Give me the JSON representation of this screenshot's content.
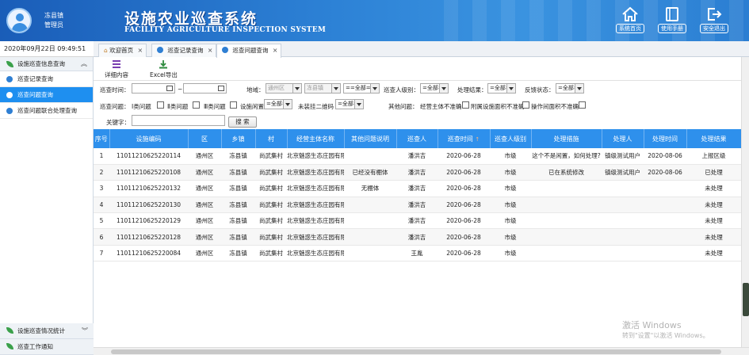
{
  "user": {
    "name": "冻县镇",
    "role": "管理员"
  },
  "system": {
    "title": "设施农业巡查系统",
    "subtitle": "FACILITY AGRICULTURE INSPECTION SYSTEM"
  },
  "header_buttons": [
    {
      "label": "系统首页",
      "icon": "home-icon"
    },
    {
      "label": "使用手册",
      "icon": "book-icon"
    },
    {
      "label": "安全退出",
      "icon": "logout-icon"
    }
  ],
  "datetime": "2020年09月22日 09:49:51",
  "sidebar": {
    "group_top": "设施巡查信息查询",
    "items": [
      "巡查记录查询",
      "巡查问题查询",
      "巡查问题联合处理查询"
    ],
    "active_index": 1,
    "group_bottom_1": "设施巡查情况统计",
    "group_bottom_2": "巡查工作通知"
  },
  "tabs": [
    {
      "label": "欢迎首页",
      "icon": "home-icon"
    },
    {
      "label": "巡查记录查询",
      "icon": "circle-icon"
    },
    {
      "label": "巡查问题查询",
      "icon": "circle-icon"
    }
  ],
  "toolbar": {
    "detail": "详细内容",
    "export": "Excel导出"
  },
  "filters": {
    "inspect_time_label": "巡查时间：",
    "date_sep": "~",
    "region_label": "地域：",
    "region_district": "通州区",
    "region_town": "冻县镇",
    "region_village": "==全部==",
    "inspector_level_label": "巡查人级别：",
    "inspector_level": "=全部=",
    "result_label": "处理结果：",
    "result": "=全部=",
    "feedback_label": "反馈状态：",
    "feedback": "=全部=",
    "issue_label": "巡查问题：",
    "issue_opts": [
      "Ⅰ类问题",
      "Ⅱ类问题",
      "Ⅲ类问题",
      "设施闲置"
    ],
    "idle_value": "=全部=",
    "qr_label": "未装挂二维码",
    "qr_value": "=全部=",
    "other_label": "其他问题：",
    "other_opts": [
      "经营主体不准确",
      "附属设施面积不准确",
      "操作间面积不准确"
    ],
    "keyword_label": "关键字：",
    "search_btn": "搜 索"
  },
  "table": {
    "columns": [
      "序号",
      "设施编码",
      "区",
      "乡镇",
      "村",
      "经营主体名称",
      "其他问题说明",
      "巡查人",
      "巡查时间",
      "巡查人级别",
      "处理措施",
      "处理人",
      "处理时间",
      "处理结果"
    ],
    "sort_mark": "↑",
    "rows": [
      [
        "1",
        "11011210625220114",
        "通州区",
        "冻县镇",
        "尚武集村",
        "北京魅惑生态庄园有限",
        "",
        "潘洪吉",
        "2020-06-28",
        "市级",
        "这个不是闲置，如何处理?",
        "镇级测试用户",
        "2020-08-06",
        "上报区级"
      ],
      [
        "2",
        "11011210625220108",
        "通州区",
        "冻县镇",
        "尚武集村",
        "北京魅惑生态庄园有限",
        "已经没有棚体",
        "潘洪吉",
        "2020-06-28",
        "市级",
        "已在系统修改",
        "镇级测试用户",
        "2020-08-06",
        "已处理"
      ],
      [
        "3",
        "11011210625220132",
        "通州区",
        "冻县镇",
        "尚武集村",
        "北京魅惑生态庄园有限",
        "无棚体",
        "潘洪吉",
        "2020-06-28",
        "市级",
        "",
        "",
        "",
        "未处理"
      ],
      [
        "4",
        "11011210625220130",
        "通州区",
        "冻县镇",
        "尚武集村",
        "北京魅惑生态庄园有限",
        "",
        "潘洪吉",
        "2020-06-28",
        "市级",
        "",
        "",
        "",
        "未处理"
      ],
      [
        "5",
        "11011210625220129",
        "通州区",
        "冻县镇",
        "尚武集村",
        "北京魅惑生态庄园有限",
        "",
        "潘洪吉",
        "2020-06-28",
        "市级",
        "",
        "",
        "",
        "未处理"
      ],
      [
        "6",
        "11011210625220128",
        "通州区",
        "冻县镇",
        "尚武集村",
        "北京魅惑生态庄园有限",
        "",
        "潘洪吉",
        "2020-06-28",
        "市级",
        "",
        "",
        "",
        "未处理"
      ],
      [
        "7",
        "11011210625220084",
        "通州区",
        "冻县镇",
        "尚武集村",
        "北京魅惑生态庄园有限",
        "",
        "王胤",
        "2020-06-28",
        "市级",
        "",
        "",
        "",
        "未处理"
      ]
    ]
  },
  "watermark": {
    "line1": "激活 Windows",
    "line2": "转到\"设置\"以激活 Windows。"
  }
}
